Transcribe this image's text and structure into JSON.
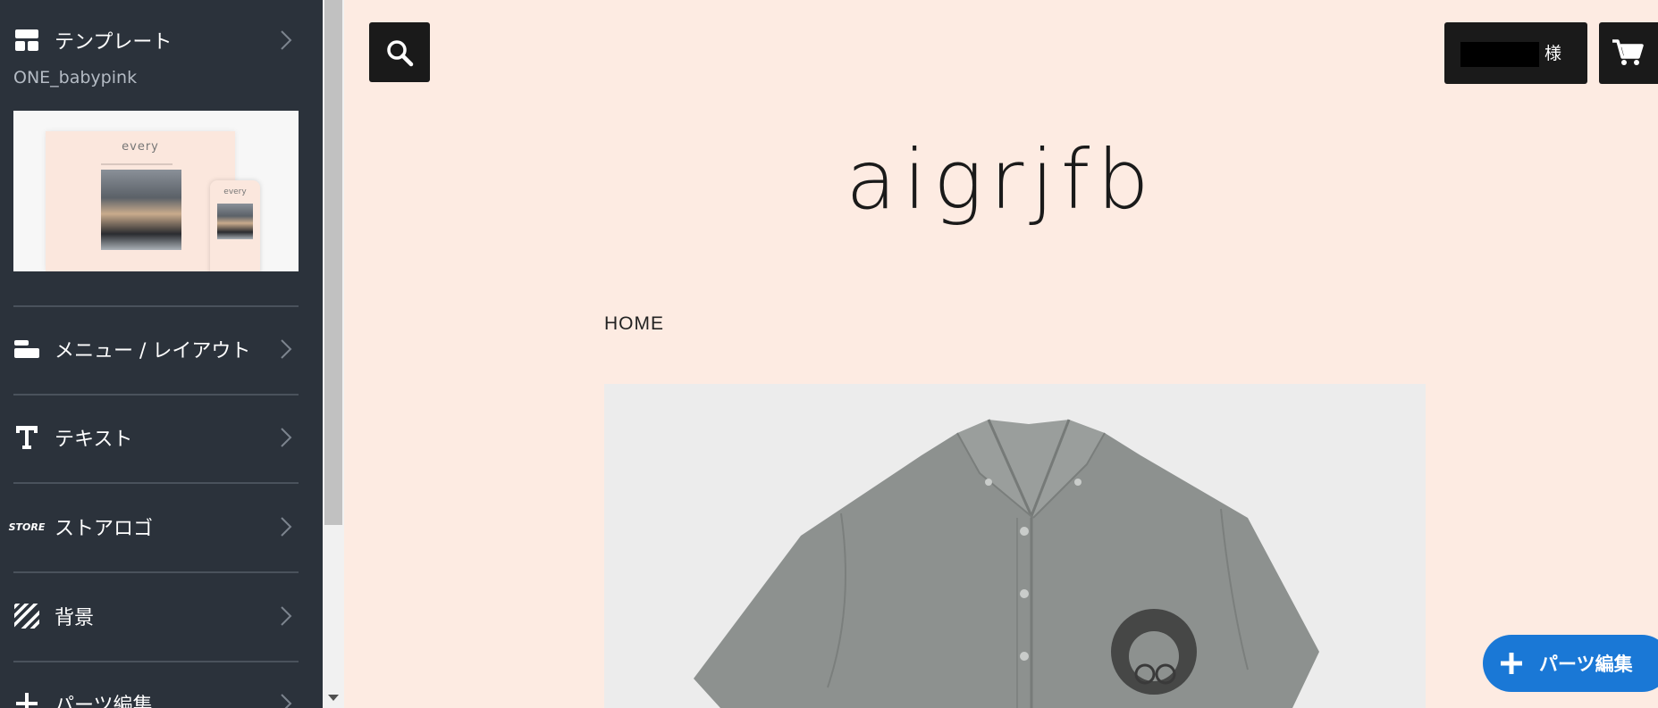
{
  "sidebar": {
    "template": {
      "label": "テンプレート",
      "name": "ONE_babypink",
      "thumbnail_title": "every",
      "thumbnail_mobile_title": "every"
    },
    "items": [
      {
        "label": "メニュー / レイアウト",
        "icon": "layout-icon"
      },
      {
        "label": "テキスト",
        "icon": "text-icon"
      },
      {
        "label": "ストアロゴ",
        "icon": "store-logo-icon"
      },
      {
        "label": "背景",
        "icon": "background-icon"
      },
      {
        "label": "パーツ編集",
        "icon": "plus-icon"
      }
    ],
    "store_icon_text": "STORE"
  },
  "header": {
    "user_suffix": "様"
  },
  "main": {
    "logo": "aigrjfb",
    "breadcrumb": "HOME"
  },
  "fab": {
    "label": "パーツ編集"
  },
  "colors": {
    "sidebar_bg": "#2b323b",
    "page_bg": "#fdebe2",
    "button_dark": "#1a1a1a",
    "fab_blue": "#1a78d6"
  }
}
